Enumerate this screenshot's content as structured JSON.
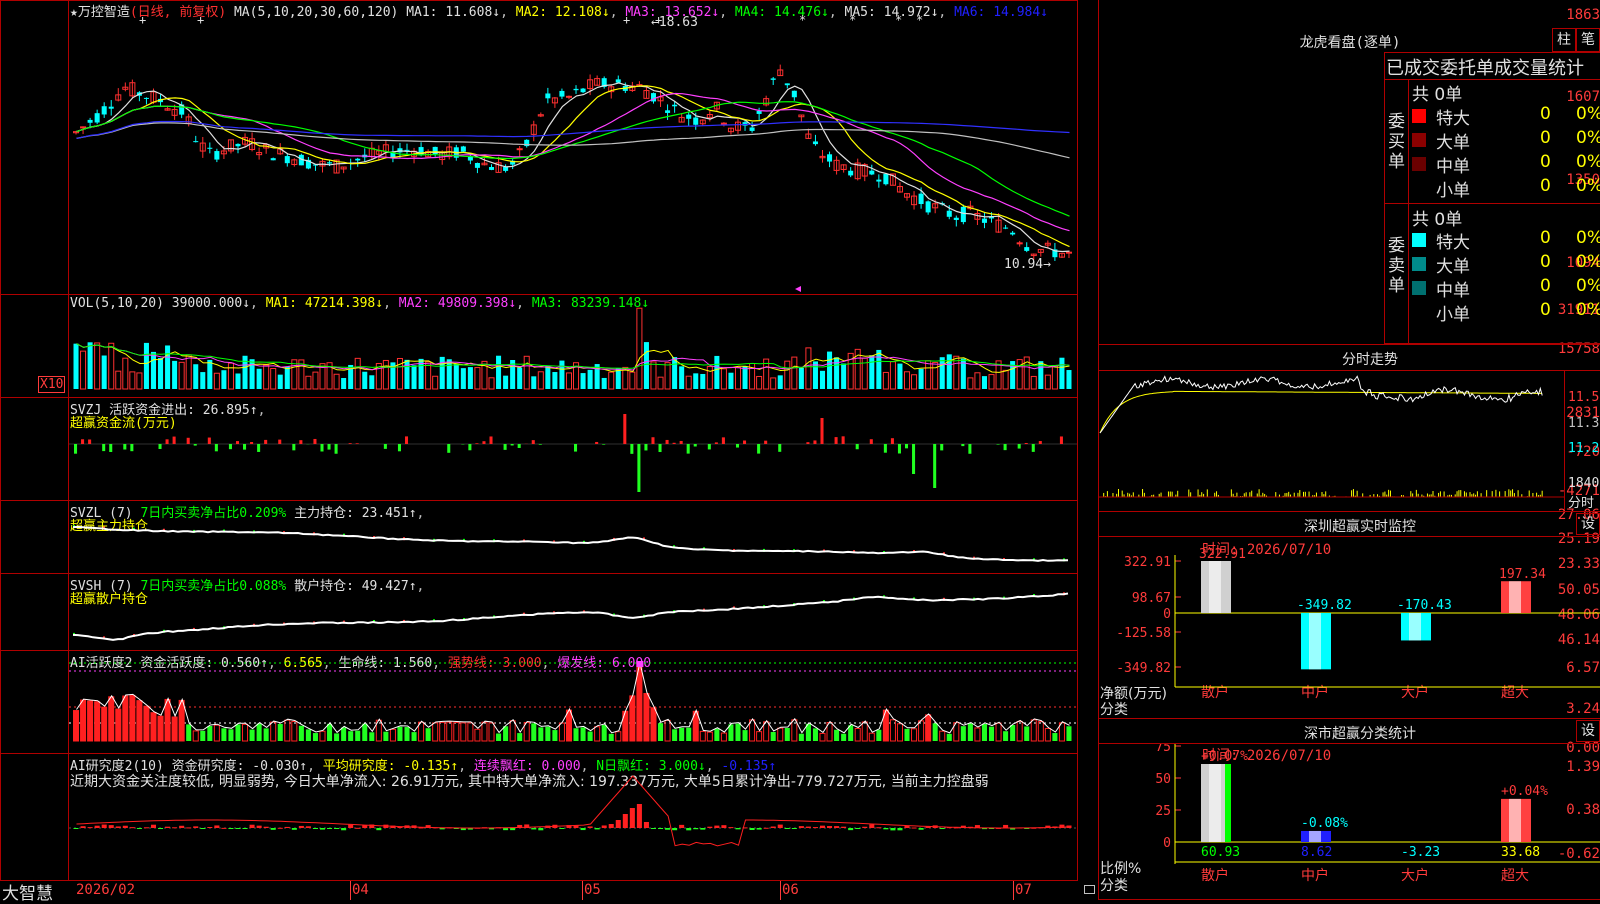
{
  "stock": {
    "star": "★",
    "name": "万控智造",
    "mode": "(日线, 前复权)",
    "ma_label": "MA(5,10,20,30,60,120)",
    "ma1": "MA1: 11.608↓",
    "ma2": "MA2: 12.108↓",
    "ma3": "MA3: 13.652↓",
    "ma4": "MA4: 14.476↓",
    "ma5": "MA5: 14.972↓",
    "ma6": "MA6: 14.984↓",
    "high_mark": "18.63",
    "low_mark": "10.94",
    "y_labels": [
      "1863",
      "1607",
      "1350",
      "1094"
    ]
  },
  "vol": {
    "header": "VOL(5,10,20)",
    "value": "39000.000↓",
    "ma1": "MA1: 47214.398↓",
    "ma2": "MA2: 49809.398↓",
    "ma3": "MA3: 83239.148↓",
    "y_labels": [
      "31911",
      "15758"
    ],
    "unit": "X10"
  },
  "svzj": {
    "header": "SVZJ",
    "label": "活跃资金进出: 26.895↑",
    "sub": "超赢资金流(万元)",
    "y_labels": [
      "2831",
      "-720",
      "-4271"
    ]
  },
  "svzl": {
    "header": "SVZL (7)",
    "ratio": "7日内买卖净占比0.209%",
    "hold": "主力持仓: 23.451↑",
    "sub": "超赢主力持仓",
    "y_labels": [
      "27.06",
      "25.19",
      "23.33"
    ]
  },
  "svsh": {
    "header": "SVSH (7)",
    "ratio": "7日内买卖净占比0.088%",
    "hold": "散户持仓: 49.427↑",
    "sub": "超赢散户持仓",
    "y_labels": [
      "50.05",
      "48.06",
      "46.14"
    ]
  },
  "ai_active": {
    "header": "AI活跃度2",
    "fund": "资金活跃度: 0.560↑",
    "v2": "6.565",
    "life": "生命线: 1.560",
    "strong": "强势线: 3.000",
    "burst": "爆发线: 6.000",
    "y_labels": [
      "6.57",
      "3.24",
      "0.00"
    ]
  },
  "ai_research": {
    "header": "AI研究度2(10)",
    "fund": "资金研究度: -0.030↑",
    "avg": "平均研究度: -0.135↑",
    "cont": "连续飘红: 0.000",
    "nday": "N日飘红: 3.000↓",
    "last": "-0.135↑",
    "comment": "近期大资金关注度较低, 明显弱势, 今日大单净流入: 26.91万元, 其中特大单净流入: 197.337万元, 大单5日累计净出-779.727万元, 当前主力控盘弱",
    "y_labels": [
      "1.39",
      "0.38",
      "-0.62"
    ]
  },
  "xaxis": {
    "brand": "大智慧",
    "labels": [
      "2026/02",
      "04",
      "05",
      "06",
      "07"
    ]
  },
  "dragon": {
    "title": "龙虎看盘(逐单)",
    "btn_bar": "柱",
    "btn_pen": "笔",
    "header": "已成交委托单成交量统计",
    "buy_label": "委买单",
    "sell_label": "委卖单",
    "buy_total": "共 0单",
    "sell_total": "共 0单",
    "buy_rows": [
      {
        "label": "特大",
        "count": "0",
        "pct": "0%",
        "color": "#ff0000"
      },
      {
        "label": "大单",
        "count": "0",
        "pct": "0%",
        "color": "#8b0000"
      },
      {
        "label": "中单",
        "count": "0",
        "pct": "0%",
        "color": "#6a0000"
      },
      {
        "label": "小单",
        "count": "0",
        "pct": "0%",
        "color": ""
      }
    ],
    "sell_rows": [
      {
        "label": "特大",
        "count": "0",
        "pct": "0%",
        "color": "#00ffff"
      },
      {
        "label": "大单",
        "count": "0",
        "pct": "0%",
        "color": "#008b8b"
      },
      {
        "label": "中单",
        "count": "0",
        "pct": "0%",
        "color": "#007070"
      },
      {
        "label": "小单",
        "count": "0",
        "pct": "0%",
        "color": ""
      }
    ]
  },
  "intraday": {
    "title": "分时走势",
    "y_labels": [
      "11.50",
      "11.35",
      "11.20"
    ],
    "vol_label": "1840",
    "time_label": "分时"
  },
  "monitor": {
    "title": "深圳超赢实时监控",
    "btn": "设",
    "time": "时间: 2026/07/10",
    "y_labels": [
      "322.91",
      "98.67",
      "0",
      "-125.58",
      "-349.82"
    ],
    "axis_note1": "净额(万元)",
    "axis_note2": "分类",
    "bars": [
      {
        "name": "散户",
        "value": "322.91"
      },
      {
        "name": "中户",
        "value": "-349.82"
      },
      {
        "name": "大户",
        "value": "-170.43"
      },
      {
        "name": "超大",
        "value": "197.34"
      }
    ]
  },
  "classify": {
    "title": "深市超赢分类统计",
    "btn": "设",
    "time": "时间: 2026/07/10",
    "y_labels": [
      "75",
      "50",
      "25",
      "0"
    ],
    "axis_note1": "比例%",
    "axis_note2": "分类",
    "bars": [
      {
        "name": "散户",
        "value": "60.93",
        "delta": "+0.07%"
      },
      {
        "name": "中户",
        "value": "8.62",
        "delta": "-0.08%"
      },
      {
        "name": "大户",
        "value": "-3.23",
        "delta": ""
      },
      {
        "name": "超大",
        "value": "33.68",
        "delta": "+0.04%"
      }
    ]
  },
  "chart_data": {
    "type": "candlestick",
    "title": "万控智造 (日线, 前复权)",
    "xlabel": "",
    "ylabel": "",
    "x_ticks": [
      "2026/02",
      "04",
      "05",
      "06",
      "07"
    ],
    "ylim": [
      10.94,
      18.63
    ],
    "high": 18.63,
    "low": 10.94,
    "ma_last": {
      "MA1": 11.608,
      "MA2": 12.108,
      "MA3": 13.652,
      "MA4": 14.476,
      "MA5": 14.972,
      "MA6": 14.984
    }
  }
}
